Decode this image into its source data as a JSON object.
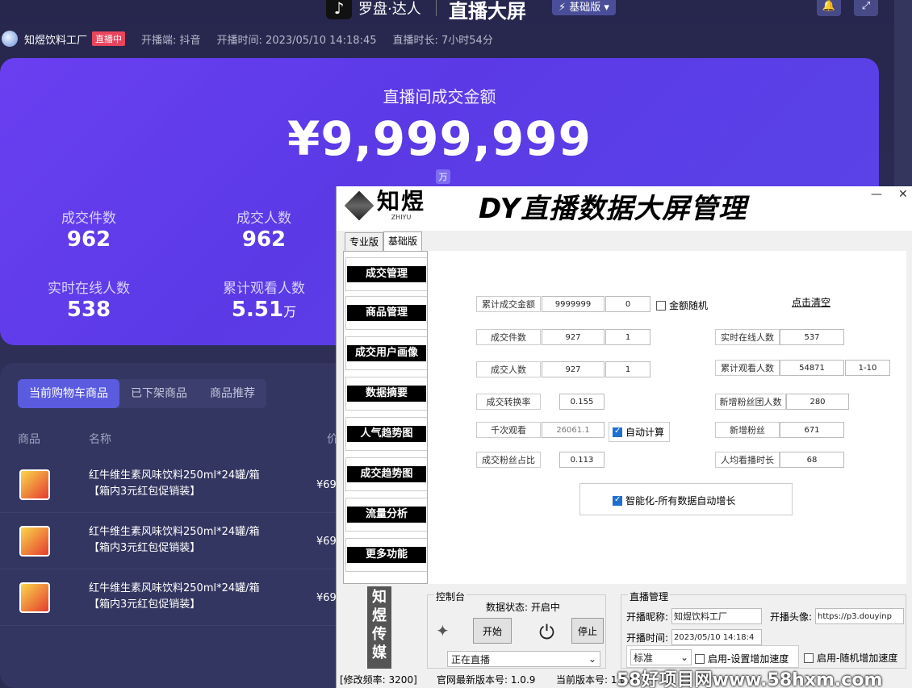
{
  "header": {
    "brand": "罗盘·达人",
    "title": "直播大屏",
    "version_badge": "基础版"
  },
  "info": {
    "shop": "知煜饮料工厂",
    "live_badge": "直播中",
    "platform": "开播端: 抖音",
    "start": "开播时间: 2023/05/10 14:18:45",
    "duration": "直播时长: 7小时54分"
  },
  "hero": {
    "title": "直播间成交金额",
    "amount": "¥9,999,999",
    "wan": "万",
    "stats": [
      {
        "label": "成交件数",
        "value": "962"
      },
      {
        "label": "成交人数",
        "value": "962"
      },
      {
        "label": "实时在线人数",
        "value": "538"
      },
      {
        "label": "累计观看人数",
        "value": "5.51",
        "unit": "万"
      }
    ]
  },
  "lower": {
    "tabs": [
      "当前购物车商品",
      "已下架商品",
      "商品推荐"
    ],
    "col_product": "商品",
    "col_name": "名称",
    "col_price": "价",
    "products": [
      {
        "name": "红牛维生素风味饮料250ml*24罐/箱",
        "note": "【箱内3元红包促销装】",
        "price": "¥69"
      },
      {
        "name": "红牛维生素风味饮料250ml*24罐/箱",
        "note": "【箱内3元红包促销装】",
        "price": "¥69"
      },
      {
        "name": "红牛维生素风味饮料250ml*24罐/箱",
        "note": "【箱内3元红包促销装】",
        "price": "¥69"
      }
    ]
  },
  "app": {
    "logo_text": "知煜",
    "logo_sub": "ZHIYU",
    "title": "DY直播数据大屏管理",
    "tabs": [
      "专业版",
      "基础版"
    ],
    "side": [
      "成交管理",
      "商品管理",
      "成交用户画像",
      "数据摘要",
      "人气趋势图",
      "成交趋势图",
      "流量分析",
      "更多功能"
    ],
    "form": {
      "amount_label": "累计成交金额",
      "amount": "9999999",
      "amount_inc": "0",
      "amount_random": "金额随机",
      "clear": "点击清空",
      "orders_label": "成交件数",
      "orders": "927",
      "orders_inc": "1",
      "buyers_label": "成交人数",
      "buyers": "927",
      "buyers_inc": "1",
      "conv_label": "成交转换率",
      "conv": "0.155",
      "kview_label": "千次观看",
      "kview": "26061.1",
      "auto_calc": "自动计算",
      "fans_label": "成交粉丝占比",
      "fans": "0.113",
      "online_label": "实时在线人数",
      "online": "537",
      "views_label": "累计观看人数",
      "views": "54871",
      "views_range": "1-10",
      "newgroup_label": "新增粉丝团人数",
      "newgroup": "280",
      "newfans_label": "新增粉丝",
      "newfans": "671",
      "avgtime_label": "人均看播时长",
      "avgtime": "68",
      "smart": "智能化-所有数据自动增长"
    },
    "vertical": "知煜传媒",
    "console": {
      "title": "控制台",
      "status": "数据状态: 开启中",
      "start": "开始",
      "stop": "停止",
      "mode": "正在直播"
    },
    "live": {
      "title": "直播管理",
      "nick_label": "开播昵称:",
      "nick": "知煜饮料工厂",
      "avatar_label": "开播头像:",
      "avatar": "https://p3.douyinp",
      "time_label": "开播时间:",
      "time": "2023/05/10 14:18:4",
      "speed": "标准",
      "opt1": "启用-设置增加速度",
      "opt2": "启用-随机增加速度"
    },
    "status": {
      "freq": "[修改频率: 3200]",
      "latest": "官网最新版本号: 1.0.9",
      "current": "当前版本号: 1.0.9"
    }
  },
  "watermark": "58好项目网www.58hxm.com"
}
